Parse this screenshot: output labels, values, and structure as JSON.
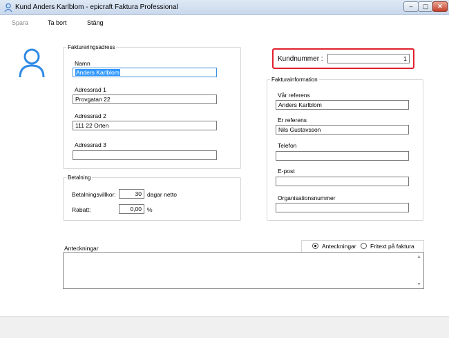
{
  "window": {
    "title": "Kund Anders Karlblom - epicraft Faktura Professional",
    "controls": {
      "minimize": "–",
      "maximize": "▢",
      "close": "✕"
    }
  },
  "menu": {
    "save": "Spara",
    "delete": "Ta bort",
    "close": "Stäng"
  },
  "billing_address": {
    "legend": "Faktureringsadress",
    "name_label": "Namn",
    "name_value": "Anders Karlblom",
    "addr1_label": "Adressrad 1",
    "addr1_value": "Provgatan 22",
    "addr2_label": "Adressrad 2",
    "addr2_value": "111 22 Orten",
    "addr3_label": "Adressrad 3",
    "addr3_value": ""
  },
  "payment": {
    "legend": "Betalning",
    "terms_label": "Betalningsvillkor:",
    "terms_value": "30",
    "terms_suffix": "dagar netto",
    "discount_label": "Rabatt:",
    "discount_value": "0,00",
    "discount_suffix": "%"
  },
  "customer_number": {
    "label": "Kundnummer :",
    "value": "1"
  },
  "invoice_info": {
    "legend": "Fakturainformation",
    "our_ref_label": "Vår referens",
    "our_ref_value": "Anders Karlblom",
    "your_ref_label": "Er referens",
    "your_ref_value": "Nils Gustavsson",
    "phone_label": "Telefon",
    "phone_value": "",
    "email_label": "E-post",
    "email_value": "",
    "org_label": "Organisationsnummer",
    "org_value": ""
  },
  "notes": {
    "label": "Anteckningar",
    "radio_notes": "Anteckningar",
    "radio_freetext": "Fritext på faktura",
    "selected": "Anteckningar",
    "value": ""
  },
  "colors": {
    "highlight_border": "#e0202c",
    "icon_blue": "#2f8ae6"
  },
  "icons": [
    "user-icon",
    "window-user-icon",
    "scroll-up-icon",
    "scroll-down-icon"
  ]
}
